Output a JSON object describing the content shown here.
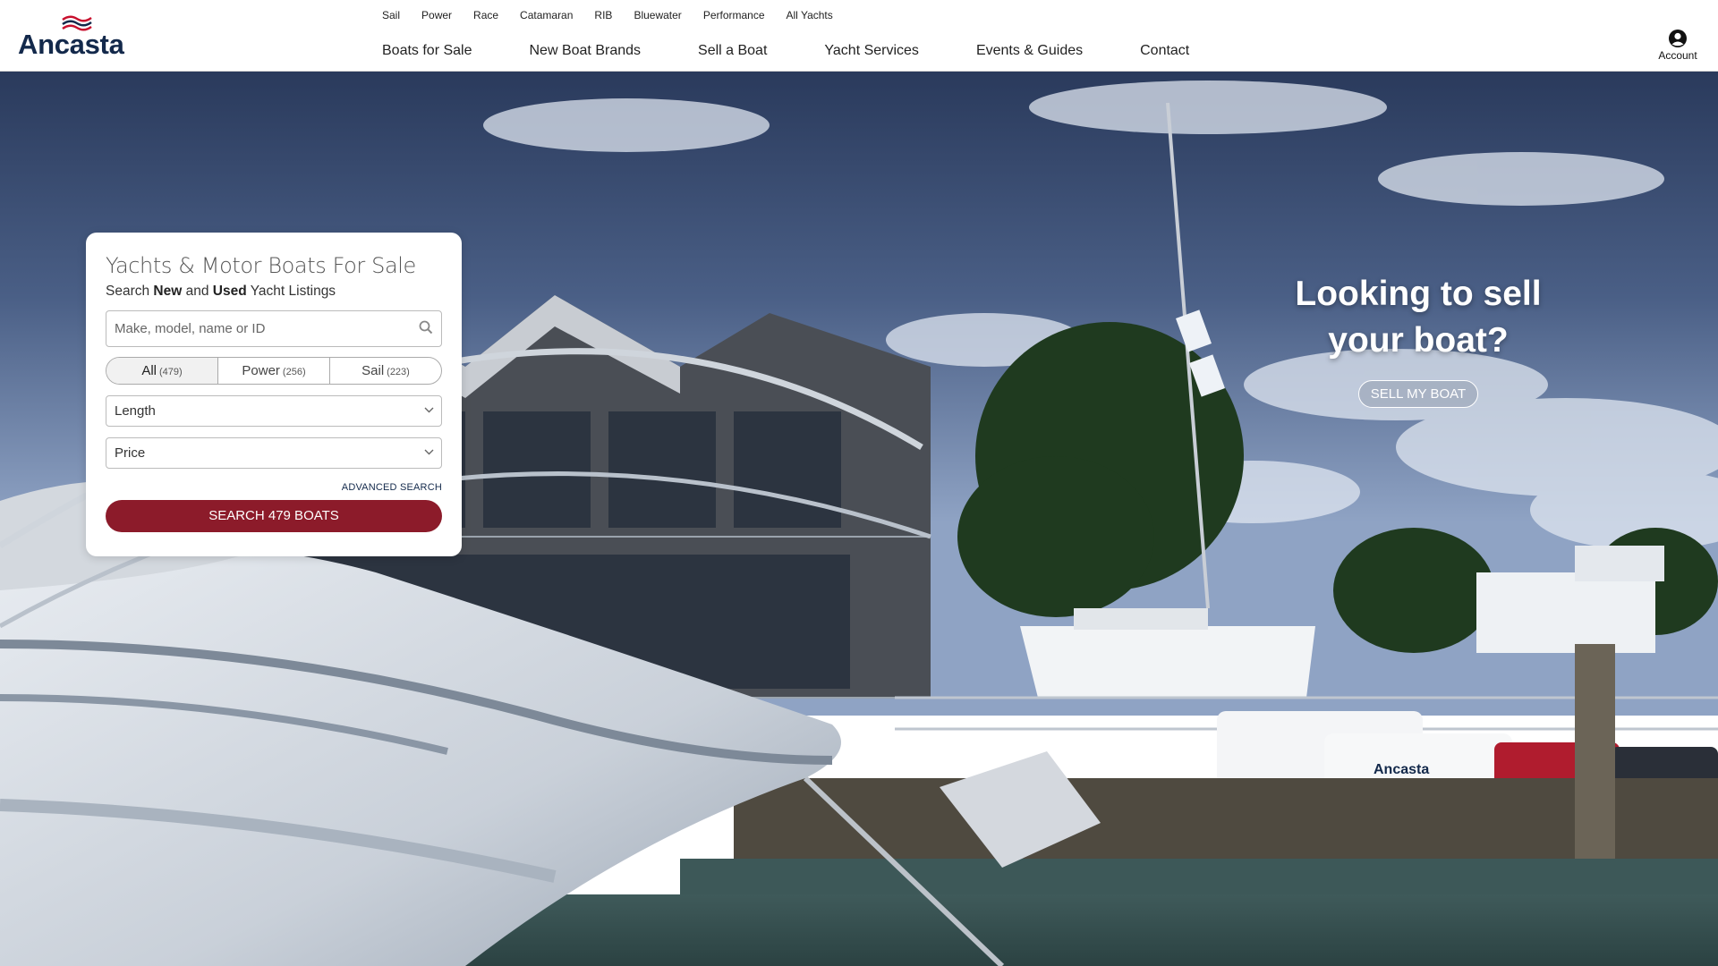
{
  "brand": {
    "name": "Ancasta",
    "color": "#13294b"
  },
  "subnav": [
    "Sail",
    "Power",
    "Race",
    "Catamaran",
    "RIB",
    "Bluewater",
    "Performance",
    "All Yachts"
  ],
  "mainnav": [
    "Boats for Sale",
    "New Boat Brands",
    "Sell a Boat",
    "Yacht Services",
    "Events & Guides",
    "Contact"
  ],
  "account": {
    "label": "Account",
    "icon": "user-circle-icon"
  },
  "search_card": {
    "title": "Yachts & Motor Boats For Sale",
    "subtitle_prefix": "Search ",
    "subtitle_new": "New",
    "subtitle_and": " and ",
    "subtitle_used": "Used",
    "subtitle_suffix": " Yacht Listings",
    "placeholder": "Make, model, name or ID",
    "segments": [
      {
        "label": "All",
        "count": "(479)",
        "active": true
      },
      {
        "label": "Power",
        "count": "(256)",
        "active": false
      },
      {
        "label": "Sail",
        "count": "(223)",
        "active": false
      }
    ],
    "length_label": "Length",
    "price_label": "Price",
    "advanced": "ADVANCED SEARCH",
    "button": "SEARCH 479 BOATS",
    "button_color": "#8c1b2a"
  },
  "sell": {
    "title_line1": "Looking to sell",
    "title_line2": "your boat?",
    "button": "SELL MY BOAT"
  },
  "hero_car_text": "Ancasta"
}
